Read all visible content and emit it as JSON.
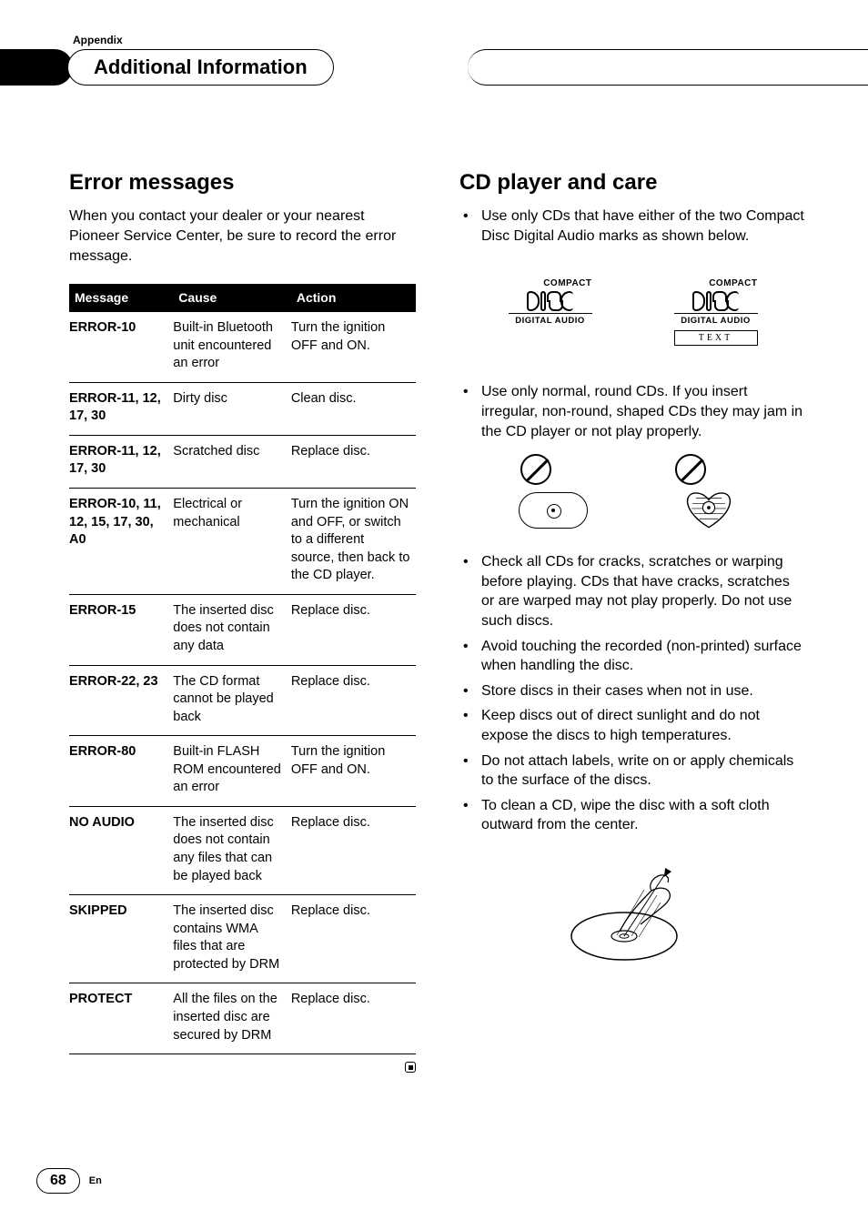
{
  "header": {
    "appendix": "Appendix",
    "section_title": "Additional Information"
  },
  "left": {
    "heading": "Error messages",
    "intro": "When you contact your dealer or your nearest Pioneer Service Center, be sure to record the error message.",
    "columns": {
      "message": "Message",
      "cause": "Cause",
      "action": "Action"
    },
    "rows": [
      {
        "message": "ERROR-10",
        "cause": "Built-in Bluetooth unit encountered an error",
        "action": "Turn the ignition OFF and ON."
      },
      {
        "message": "ERROR-11, 12, 17, 30",
        "cause": "Dirty disc",
        "action": "Clean disc."
      },
      {
        "message": "ERROR-11, 12, 17, 30",
        "cause": "Scratched disc",
        "action": "Replace disc."
      },
      {
        "message": "ERROR-10, 11, 12, 15, 17, 30, A0",
        "cause": "Electrical or mechanical",
        "action": "Turn the ignition ON and OFF, or switch to a different source, then back to the CD player."
      },
      {
        "message": "ERROR-15",
        "cause": "The inserted disc does not contain any data",
        "action": "Replace disc."
      },
      {
        "message": "ERROR-22, 23",
        "cause": "The CD format cannot be played back",
        "action": "Replace disc."
      },
      {
        "message": "ERROR-80",
        "cause": "Built-in FLASH ROM encountered an error",
        "action": "Turn the ignition OFF and ON."
      },
      {
        "message": "NO AUDIO",
        "cause": "The inserted disc does not contain any files that can be played back",
        "action": "Replace disc."
      },
      {
        "message": "SKIPPED",
        "cause": "The inserted disc contains WMA files that are protected by DRM",
        "action": "Replace disc."
      },
      {
        "message": "PROTECT",
        "cause": "All the files on the inserted disc are secured by DRM",
        "action": "Replace disc."
      }
    ]
  },
  "right": {
    "heading": "CD player and care",
    "bullets_top": [
      "Use only CDs that have either of the two Compact Disc Digital Audio marks as shown below."
    ],
    "logo": {
      "compact": "COMPACT",
      "digital_audio": "DIGITAL AUDIO",
      "text": "TEXT"
    },
    "bullets_mid": [
      "Use only normal, round CDs. If you insert irregular, non-round, shaped CDs they may jam in the CD player or not play properly."
    ],
    "bullets_bottom": [
      "Check all CDs for cracks, scratches or warping before playing. CDs that have cracks, scratches or are warped may not play properly. Do not use such discs.",
      "Avoid touching the recorded (non-printed) surface when handling the disc.",
      "Store discs in their cases when not in use.",
      "Keep discs out of direct sunlight and do not expose the discs to high temperatures.",
      "Do not attach labels, write on or apply chemicals to the surface of the discs.",
      "To clean a CD, wipe the disc with a soft cloth outward from the center."
    ]
  },
  "footer": {
    "page": "68",
    "lang": "En"
  }
}
